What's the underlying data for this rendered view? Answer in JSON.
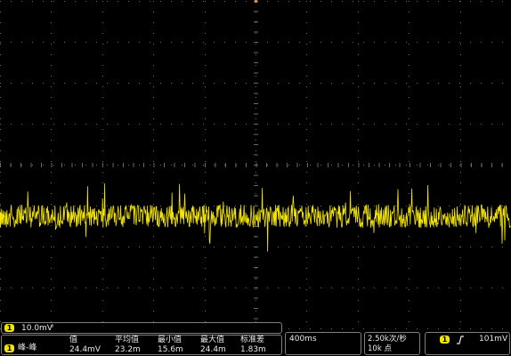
{
  "trace": {
    "color": "#f5e600"
  },
  "channel": {
    "number": "1",
    "scale": "10.0mV",
    "bw_symbol": "⁶"
  },
  "measurement": {
    "label": "峰-峰",
    "headers": [
      "值",
      "平均值",
      "最小值",
      "最大值",
      "标准差"
    ],
    "values": [
      "24.4mV",
      "23.2m",
      "15.6m",
      "24.4m",
      "1.83m"
    ]
  },
  "timebase": {
    "scale": "400ms"
  },
  "acquisition": {
    "rate": "2.50k次/秒",
    "record_length": "10k 点"
  },
  "trigger": {
    "source": "1",
    "slope_icon": "rising-edge-icon",
    "level": "101mV"
  }
}
